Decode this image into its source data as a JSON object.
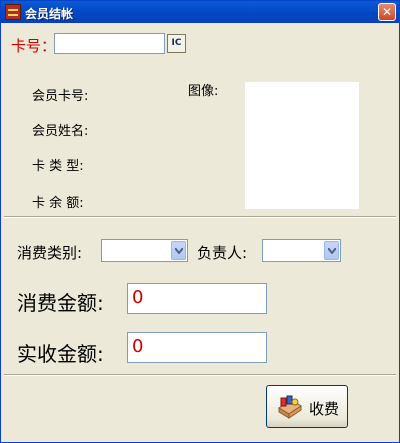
{
  "window": {
    "title": "会员结帐",
    "close_symbol": "✕"
  },
  "card": {
    "label": "卡号：",
    "value": "",
    "ic_button_label": "IC"
  },
  "member_info": {
    "card_no_label": "会员卡号:",
    "name_label": "会员姓名:",
    "card_type_label": "卡 类 型:",
    "balance_label": "卡 余 额:",
    "photo_label": "图像:"
  },
  "consumption": {
    "category_label": "消费类别:",
    "category_value": "",
    "responsible_label": "负责人:",
    "responsible_value": "",
    "amount_label": "消费金额:",
    "amount_value": "0",
    "received_label": "实收金额:",
    "received_value": "0"
  },
  "actions": {
    "charge_label": "收费"
  },
  "colors": {
    "title_bar": "#0349c7",
    "accent_red": "#cc0000",
    "window_bg": "#ece9d8"
  }
}
